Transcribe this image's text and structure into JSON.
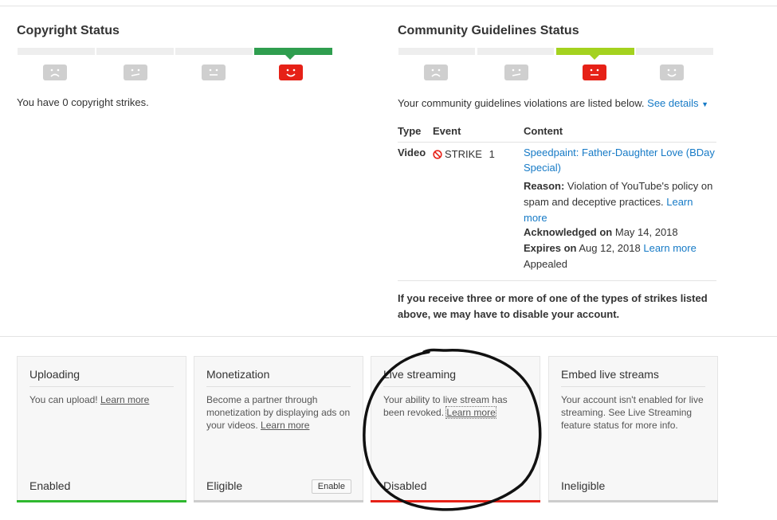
{
  "copyright": {
    "title": "Copyright Status",
    "level_index": 3,
    "bar_color": "#2f9e4f",
    "face_icons": [
      "sad-face-icon",
      "meh-face-icon",
      "neutral-face-icon",
      "happy-face-icon"
    ],
    "summary": "You have 0 copyright strikes."
  },
  "community": {
    "title": "Community Guidelines Status",
    "level_index": 2,
    "bar_color": "#a4d21f",
    "face_icons": [
      "sad-face-icon",
      "meh-face-icon",
      "neutral-face-icon",
      "happy-face-icon"
    ],
    "summary": "Your community guidelines violations are listed below.",
    "see_details": "See details",
    "table": {
      "headers": {
        "type": "Type",
        "event": "Event",
        "content": "Content"
      },
      "row": {
        "type": "Video",
        "event": "STRIKE",
        "count": "1",
        "video_title_line1": "Speedpaint: Father-Daughter Love (BDay",
        "video_title_line2": "Special)",
        "reason_label": "Reason:",
        "reason_line1": "Violation of YouTube's policy on",
        "reason_line2": "spam and deceptive practices.",
        "learn": "Learn",
        "more": "more",
        "ack_label": "Acknowledged on",
        "ack_date": "May 14, 2018",
        "expires_label": "Expires on",
        "expires_date": "Aug 12, 2018",
        "expires_learn_more": "Learn more",
        "appealed": "Appealed"
      }
    },
    "warning_line1": "If you receive three or more of one of the types of strikes listed",
    "warning_line2": "above, we may have to disable your account."
  },
  "cards": [
    {
      "title": "Uploading",
      "body": "You can upload!",
      "link": "Learn more",
      "status": "Enabled",
      "bar_color": "#2fb82f"
    },
    {
      "title": "Monetization",
      "body_line1": "Become a partner through",
      "body_line2": "monetization by displaying ads on",
      "body_line3": "your videos.",
      "link": "Learn more",
      "status": "Eligible",
      "button": "Enable",
      "bar_color": "#cccccc"
    },
    {
      "title": "Live streaming",
      "body_line1": "Your ability to live stream has",
      "body_line2": "been revoked.",
      "link": "Learn more",
      "status": "Disabled",
      "bar_color": "#e62117"
    },
    {
      "title": "Embed live streams",
      "body_line1": "Your account isn't enabled for live",
      "body_line2": "streaming. See Live Streaming",
      "body_line3": "feature status for more info.",
      "status": "Ineligible",
      "bar_color": "#cccccc"
    }
  ]
}
